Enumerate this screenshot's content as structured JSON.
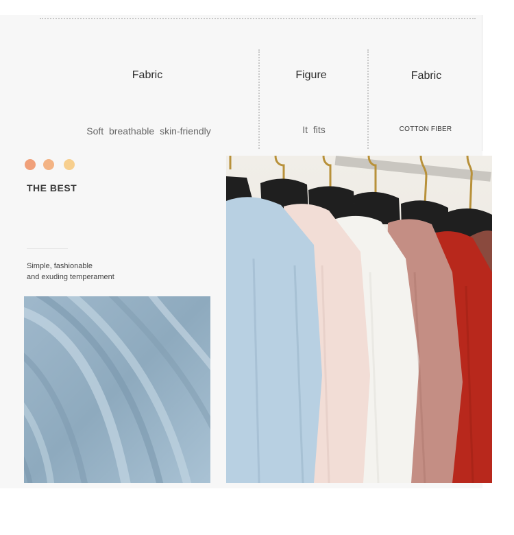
{
  "columns": [
    {
      "title": "Fabric",
      "subtitle": "Soft  breathable  skin-friendly"
    },
    {
      "title": "Figure",
      "subtitle": "It fits"
    },
    {
      "title": "Fabric",
      "subtitle": "COTTON FIBER"
    }
  ],
  "accent_dots": [
    "#f0a07a",
    "#f3b384",
    "#f7cf8e"
  ],
  "heading": "THE BEST",
  "description": {
    "line1": "Simple, fashionable",
    "line2": "and exuding temperament"
  },
  "shirt_colors": [
    "#b8d0e2",
    "#f2ddd6",
    "#f4f3ef",
    "#c48e84",
    "#b8281c",
    "#8a4a3e"
  ]
}
